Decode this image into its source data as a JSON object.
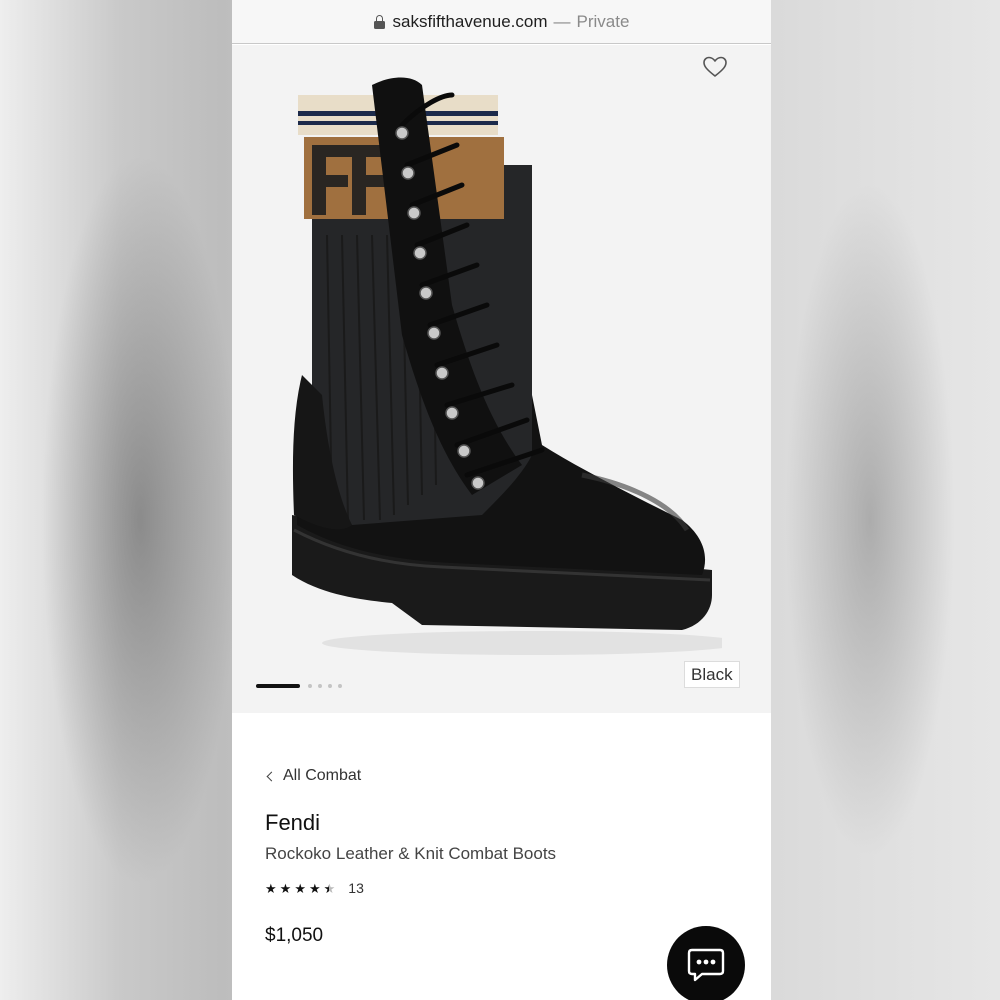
{
  "browser": {
    "domain": "saksfifthavenue.com",
    "separator": "—",
    "mode": "Private"
  },
  "gallery": {
    "selected_color": "Black",
    "image_count": 5,
    "active_index": 0
  },
  "product": {
    "breadcrumb": "All Combat",
    "brand": "Fendi",
    "name": "Rockoko Leather & Knit Combat Boots",
    "rating": 4.5,
    "review_count": "13",
    "price": "$1,050"
  },
  "icons": {
    "lock": "lock-icon",
    "wishlist": "heart-outline-icon",
    "back": "chevron-left-icon",
    "chat": "chat-bubble-icon"
  },
  "colors": {
    "accent": "#111111",
    "background": "#f3f3f3"
  }
}
